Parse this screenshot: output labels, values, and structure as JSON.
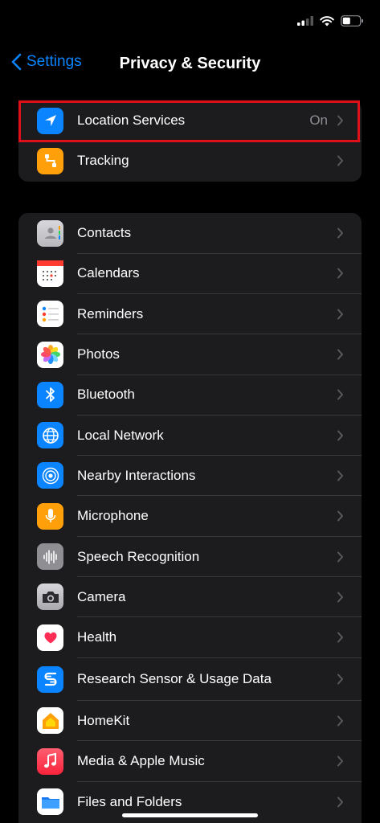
{
  "nav": {
    "back_label": "Settings",
    "title": "Privacy & Security"
  },
  "group1": [
    {
      "label": "Location Services",
      "value": "On",
      "icon": "location-arrow-icon",
      "color": "#0a84ff"
    },
    {
      "label": "Tracking",
      "value": "",
      "icon": "tracking-icon",
      "color": "#ff9f0a"
    }
  ],
  "group2": [
    {
      "label": "Contacts",
      "icon": "contacts-icon"
    },
    {
      "label": "Calendars",
      "icon": "calendar-icon"
    },
    {
      "label": "Reminders",
      "icon": "reminders-icon"
    },
    {
      "label": "Photos",
      "icon": "photos-icon"
    },
    {
      "label": "Bluetooth",
      "icon": "bluetooth-icon"
    },
    {
      "label": "Local Network",
      "icon": "globe-icon"
    },
    {
      "label": "Nearby Interactions",
      "icon": "nearby-icon"
    },
    {
      "label": "Microphone",
      "icon": "microphone-icon"
    },
    {
      "label": "Speech Recognition",
      "icon": "waveform-icon"
    },
    {
      "label": "Camera",
      "icon": "camera-icon"
    },
    {
      "label": "Health",
      "icon": "heart-icon"
    },
    {
      "label": "Research Sensor & Usage Data",
      "icon": "research-icon"
    },
    {
      "label": "HomeKit",
      "icon": "home-icon"
    },
    {
      "label": "Media & Apple Music",
      "icon": "music-note-icon"
    },
    {
      "label": "Files and Folders",
      "icon": "folder-icon"
    }
  ],
  "colors": {
    "accent": "#0a84ff",
    "highlight": "#e0101a",
    "row_bg": "#1c1c1e"
  }
}
